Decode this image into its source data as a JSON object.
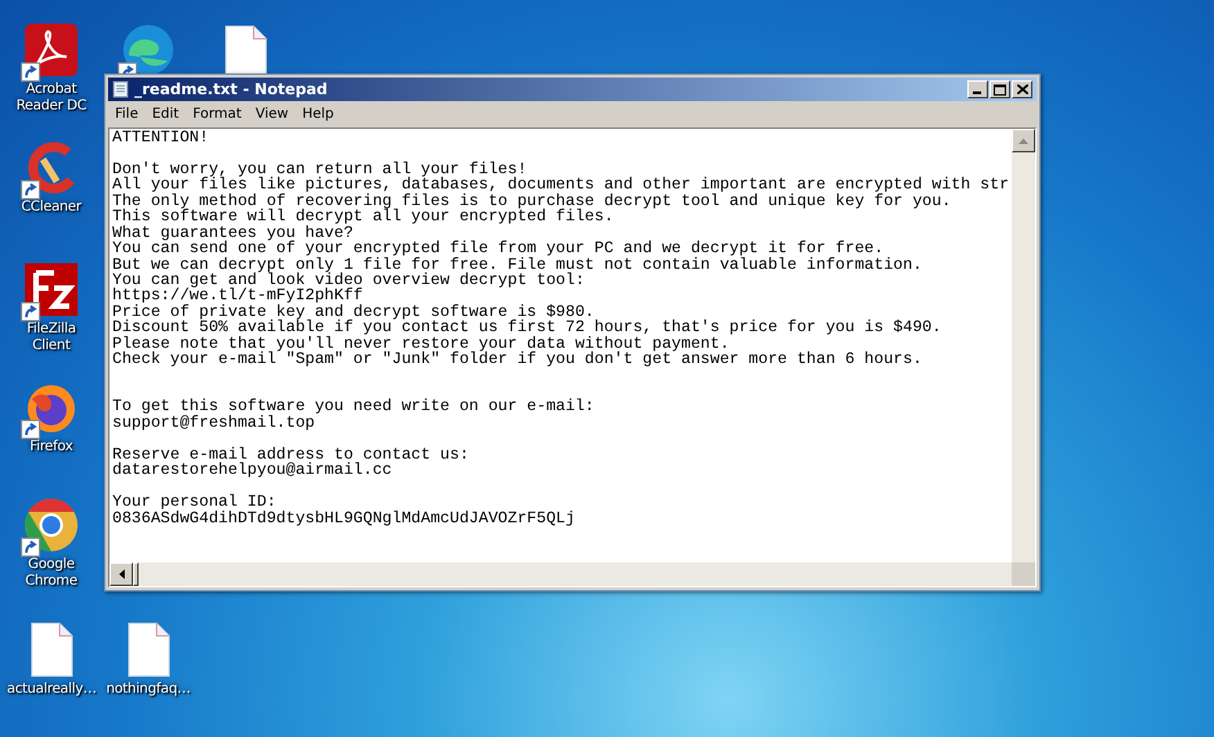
{
  "desktop_icons": [
    {
      "kind": "pdf",
      "label": "Acrobat Reader DC",
      "shortcut": true
    },
    {
      "kind": "ccleaner",
      "label": "CCleaner",
      "shortcut": true
    },
    {
      "kind": "filezilla",
      "label": "FileZilla Client",
      "shortcut": true
    },
    {
      "kind": "firefox",
      "label": "Firefox",
      "shortcut": true
    },
    {
      "kind": "chrome",
      "label": "Google Chrome",
      "shortcut": true
    },
    {
      "kind": "edge",
      "shortcut": true
    },
    {
      "kind": "file",
      "shortcut": false
    },
    {
      "kind": "file",
      "label": "actualreally…",
      "shortcut": false
    },
    {
      "kind": "file",
      "label": "nothingfaq…",
      "shortcut": false
    }
  ],
  "window": {
    "title": "_readme.txt - Notepad",
    "menu": [
      "File",
      "Edit",
      "Format",
      "View",
      "Help"
    ],
    "lines": [
      {
        "kind": "text",
        "text": "ATTENTION!"
      },
      {
        "kind": "blank"
      },
      {
        "kind": "text",
        "text": "Don't worry, you can return all your files!"
      },
      {
        "kind": "text",
        "text": "All your files like pictures, databases, documents and other important are encrypted with str"
      },
      {
        "kind": "text",
        "text": "The only method of recovering files is to purchase decrypt tool and unique key for you."
      },
      {
        "kind": "text",
        "text": "This software will decrypt all your encrypted files."
      },
      {
        "kind": "text",
        "text": "What guarantees you have?"
      },
      {
        "kind": "text",
        "text": "You can send one of your encrypted file from your PC and we decrypt it for free."
      },
      {
        "kind": "text",
        "text": "But we can decrypt only 1 file for free. File must not contain valuable information."
      },
      {
        "kind": "text",
        "text": "You can get and look video overview decrypt tool:"
      },
      {
        "kind": "text",
        "text": "https://we.tl/t-mFyI2phKff"
      },
      {
        "kind": "text",
        "text": "Price of private key and decrypt software is $980."
      },
      {
        "kind": "text",
        "text": "Discount 50% available if you contact us first 72 hours, that's price for you is $490."
      },
      {
        "kind": "text",
        "text": "Please note that you'll never restore your data without payment."
      },
      {
        "kind": "text",
        "text": "Check your e-mail \"Spam\" or \"Junk\" folder if you don't get answer more than 6 hours."
      },
      {
        "kind": "blank"
      },
      {
        "kind": "blank"
      },
      {
        "kind": "text",
        "text": "To get this software you need write on our e-mail:"
      },
      {
        "kind": "text",
        "text": "support@freshmail.top"
      },
      {
        "kind": "blank"
      },
      {
        "kind": "text",
        "text": "Reserve e-mail address to contact us:"
      },
      {
        "kind": "text",
        "text": "datarestorehelpyou@airmail.cc"
      },
      {
        "kind": "blank"
      },
      {
        "kind": "text",
        "text": "Your personal ID:"
      },
      {
        "kind": "text",
        "text": "0836ASdwG4dihDTd9dtysbHL9GQNglMdAmcUdJAVOZrF5QLj"
      }
    ]
  }
}
